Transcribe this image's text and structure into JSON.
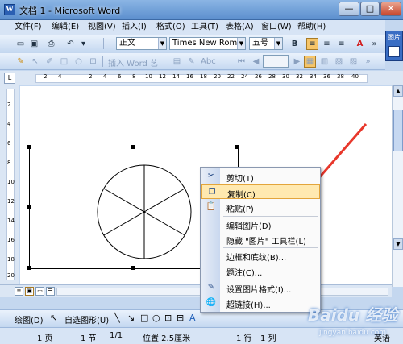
{
  "window": {
    "title": "文档 1 - Microsoft Word",
    "app_icon": "W",
    "minimize_glyph": "—",
    "maximize_glyph": "□",
    "close_glyph": "✕"
  },
  "menubar": {
    "items": [
      "文件(F)",
      "编辑(E)",
      "视图(V)",
      "插入(I)",
      "格式(O)",
      "工具(T)",
      "表格(A)",
      "窗口(W)",
      "帮助(H)"
    ]
  },
  "formatting": {
    "style": "正文",
    "font": "Times New Roman",
    "size": "五号",
    "bold": "B"
  },
  "drawing_group": {
    "insert_wordart": "插入 Word 艺"
  },
  "picture_toolbar": {
    "label": "图片"
  },
  "ruler": {
    "ticks": [
      "2",
      "4",
      "2",
      "4",
      "6",
      "8",
      "10",
      "12",
      "14",
      "16",
      "18",
      "20",
      "22",
      "24",
      "26",
      "28",
      "30",
      "32",
      "34",
      "36",
      "38",
      "40"
    ],
    "vticks": [
      "2",
      "4",
      "6",
      "8",
      "10",
      "12",
      "14",
      "16",
      "18",
      "20"
    ]
  },
  "context_menu": {
    "items": [
      {
        "label": "剪切(T)",
        "icon": "scissors-icon"
      },
      {
        "label": "复制(C)",
        "icon": "copy-icon",
        "highlighted": true
      },
      {
        "label": "粘贴(P)",
        "icon": "paste-icon"
      },
      {
        "label": "编辑图片(D)",
        "icon": ""
      },
      {
        "label": "隐藏 \"图片\" 工具栏(L)",
        "icon": ""
      },
      {
        "label": "边框和底纹(B)...",
        "icon": ""
      },
      {
        "label": "题注(C)...",
        "icon": ""
      },
      {
        "label": "设置图片格式(I)...",
        "icon": "format-picture-icon"
      },
      {
        "label": "超链接(H)...",
        "icon": "hyperlink-icon"
      }
    ]
  },
  "drawbar": {
    "draw": "绘图(D)",
    "autoshapes": "自选图形(U)"
  },
  "status": {
    "page": "1 页",
    "section": "1 节",
    "page_of": "1/1",
    "position": "位置 2.5厘米",
    "line": "1 行",
    "column": "1 列",
    "language": "英语"
  },
  "watermark": {
    "main": "Baidu 经验",
    "sub": "jingyan.baidu.com"
  },
  "colors": {
    "accent": "#f6c569",
    "arrow": "#e8372b"
  }
}
